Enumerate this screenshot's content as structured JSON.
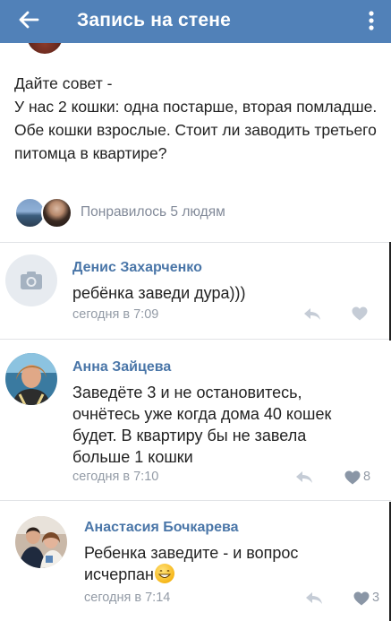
{
  "header": {
    "title": "Запись на стене",
    "back_icon": "arrow-left-icon",
    "menu_icon": "more-vertical-icon",
    "background": "#5181b8"
  },
  "post": {
    "text": "Дайте совет -\nУ нас 2 кошки: одна постарше, вторая помладше.\nОбе кошки взрослые. Стоит ли заводить третьего питомца в квартире?",
    "likes_text": "Понравилось 5 людям"
  },
  "comments": [
    {
      "author": "Денис Захарченко",
      "text": "ребёнка заведи дура)))",
      "date": "сегодня в 7:09",
      "likes": "",
      "avatar_icon": "camera-icon"
    },
    {
      "author": "Анна Зайцева",
      "text": "Заведёте 3 и не остановитесь, очнётесь уже когда дома 40 кошек будет. В квартиру бы не завела больше 1 кошки",
      "date": "сегодня в 7:10",
      "likes": "8"
    },
    {
      "author": "Анастасия Бочкарева",
      "text": "Ребенка заведите - и вопрос исчерпан",
      "date": "сегодня в 7:14",
      "likes": "3",
      "emoji_icon": "grinning-face-emoji"
    }
  ],
  "colors": {
    "author_name": "#4a76a8",
    "meta": "#939ba6",
    "separator": "#e1e3e6"
  }
}
